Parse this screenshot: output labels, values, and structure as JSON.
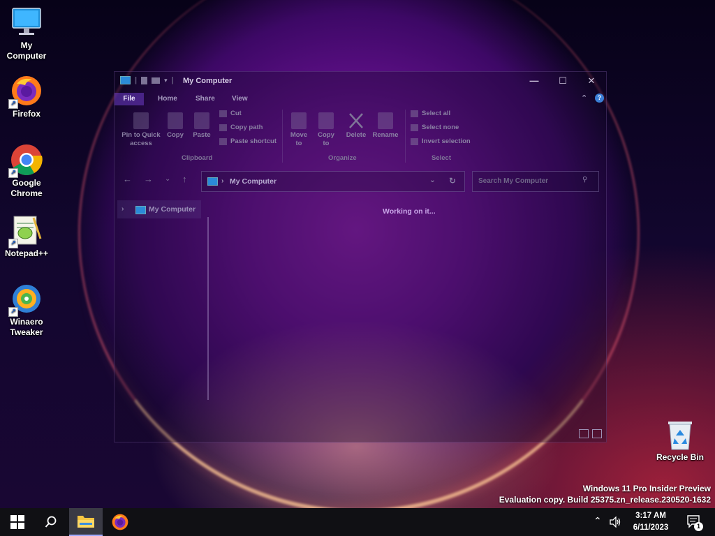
{
  "desktop": {
    "icons": [
      {
        "label": "My\nComputer",
        "icon": "monitor-icon",
        "shortcut": false
      },
      {
        "label": "Firefox",
        "icon": "firefox-icon",
        "shortcut": true
      },
      {
        "label": "Google\nChrome",
        "icon": "chrome-icon",
        "shortcut": true
      },
      {
        "label": "Notepad++",
        "icon": "notepadpp-icon",
        "shortcut": true
      },
      {
        "label": "Winaero\nTweaker",
        "icon": "winaero-tweaker-icon",
        "shortcut": true
      }
    ],
    "recycle_bin": {
      "label": "Recycle Bin",
      "icon": "recycle-bin-icon"
    }
  },
  "explorer": {
    "title": "My Computer",
    "tabs": {
      "file": "File",
      "home": "Home",
      "share": "Share",
      "view": "View"
    },
    "ribbon": {
      "pin": "Pin to Quick access",
      "copy": "Copy",
      "paste": "Paste",
      "cut": "Cut",
      "copy_path": "Copy path",
      "paste_shortcut": "Paste shortcut",
      "move_to": "Move to",
      "copy_to": "Copy to",
      "delete": "Delete",
      "rename": "Rename",
      "select_all": "Select all",
      "select_none": "Select none",
      "invert_selection": "Invert selection",
      "groups": {
        "clipboard": "Clipboard",
        "organize": "Organize",
        "select": "Select"
      }
    },
    "address": {
      "path": "My Computer"
    },
    "search": {
      "placeholder": "Search My Computer"
    },
    "navpane": {
      "item": "My Computer"
    },
    "status": "Working on it..."
  },
  "watermark": {
    "line1": "Windows 11 Pro Insider Preview",
    "line2": "Evaluation copy. Build 25375.zn_release.230520-1632"
  },
  "taskbar": {
    "time": "3:17 AM",
    "date": "6/11/2023",
    "notification_count": "1"
  },
  "colors": {
    "accent": "#6e3cc8",
    "taskbar": "#101014"
  }
}
